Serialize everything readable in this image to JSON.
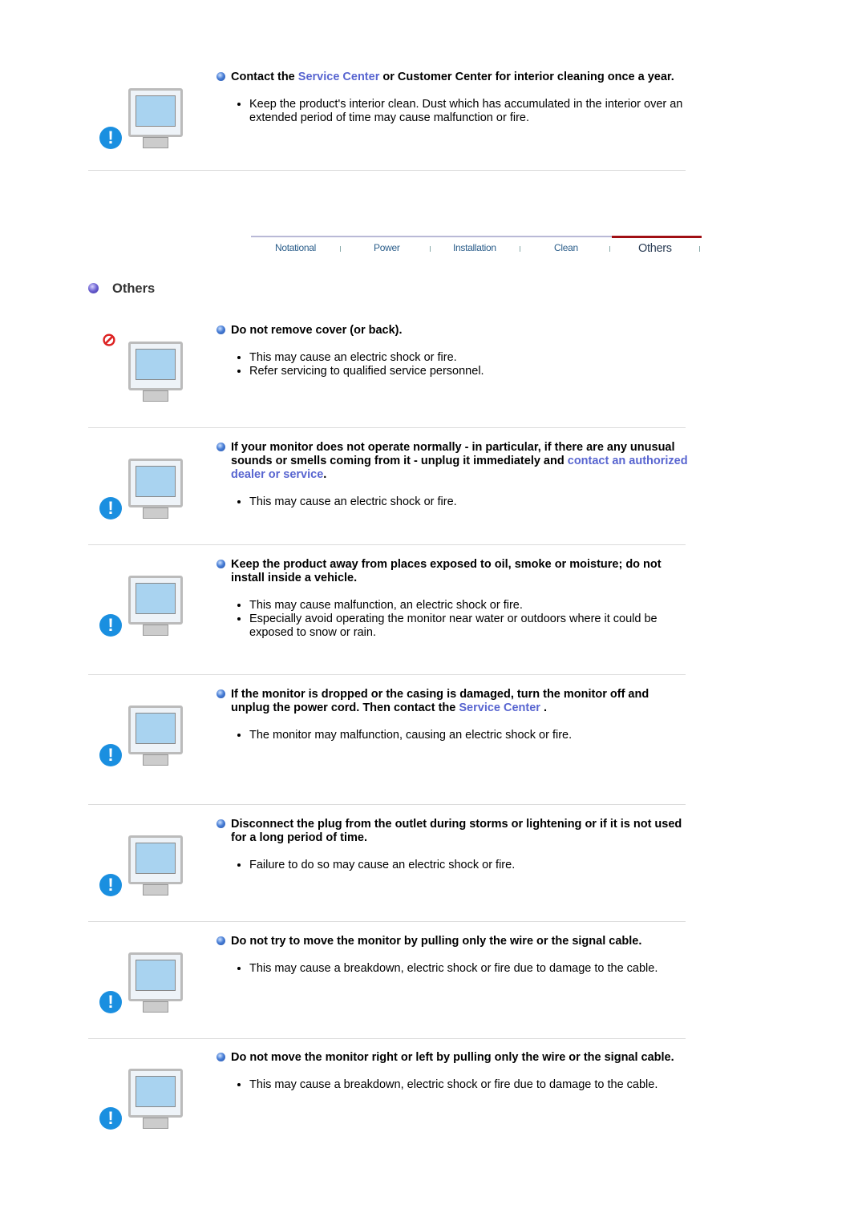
{
  "colors": {
    "link": "#5865d0",
    "active_tab_bar": "#a00f14",
    "tab_text": "#2a5d8a",
    "warning_icon": "#1a8fe0"
  },
  "tabs": [
    {
      "label": "Notational",
      "active": false
    },
    {
      "label": "Power",
      "active": false
    },
    {
      "label": "Installation",
      "active": false
    },
    {
      "label": "Clean",
      "active": false
    },
    {
      "label": "Others",
      "active": true
    }
  ],
  "section_heading": "Others",
  "items": [
    {
      "icon": "monitor-phone-warning-icon",
      "title": [
        {
          "text": "Contact the "
        },
        {
          "text": "Service Center",
          "link": true
        },
        {
          "text": " or Customer Center for interior cleaning once a year."
        }
      ],
      "bullets": [
        "Keep the product's interior clean. Dust which has accumulated in the interior over an extended period of time may cause malfunction or fire."
      ]
    },
    {
      "icon": "no-disassembly-icon",
      "title": [
        {
          "text": "Do not remove cover (or back)."
        }
      ],
      "bullets": [
        "This may cause an electric shock or fire.",
        "Refer servicing to qualified service personnel."
      ]
    },
    {
      "icon": "unplug-monitor-icon",
      "title": [
        {
          "text": "If your monitor does not operate normally - in particular, if there are any unusual sounds or smells coming from it - unplug it immediately and "
        },
        {
          "text": "contact an authorized dealer or service",
          "link": true
        },
        {
          "text": "."
        }
      ],
      "bullets": [
        "This may cause an electric shock or fire."
      ]
    },
    {
      "icon": "moisture-warning-icon",
      "title": [
        {
          "text": "Keep the product away from places exposed to oil, smoke or moisture; do not install inside a vehicle."
        }
      ],
      "bullets": [
        "This may cause malfunction, an electric shock or fire.",
        "Especially avoid operating the monitor near water or outdoors where it could be exposed to snow or rain."
      ]
    },
    {
      "icon": "dropped-monitor-icon",
      "title": [
        {
          "text": "If the monitor is dropped or the casing is damaged, turn the monitor off and unplug the power cord. Then contact the "
        },
        {
          "text": "Service Center",
          "link": true
        },
        {
          "text": " ."
        }
      ],
      "bullets": [
        "The monitor may malfunction, causing an electric shock or fire."
      ]
    },
    {
      "icon": "storm-unplug-icon",
      "title": [
        {
          "text": "Disconnect the plug from the outlet during storms or lightening or if it is not used for a long period of time."
        }
      ],
      "bullets": [
        "Failure to do so may cause an electric shock or fire."
      ]
    },
    {
      "icon": "pull-wire-warning-icon",
      "title": [
        {
          "text": "Do not try to move the monitor by pulling only the wire or the signal cable."
        }
      ],
      "bullets": [
        "This may cause a breakdown, electric shock or fire due to damage to the cable."
      ]
    },
    {
      "icon": "pull-sideways-warning-icon",
      "title": [
        {
          "text": "Do not move the monitor right or left by pulling only the wire or the signal cable."
        }
      ],
      "bullets": [
        "This may cause a breakdown, electric shock or fire due to damage to the cable."
      ]
    }
  ]
}
